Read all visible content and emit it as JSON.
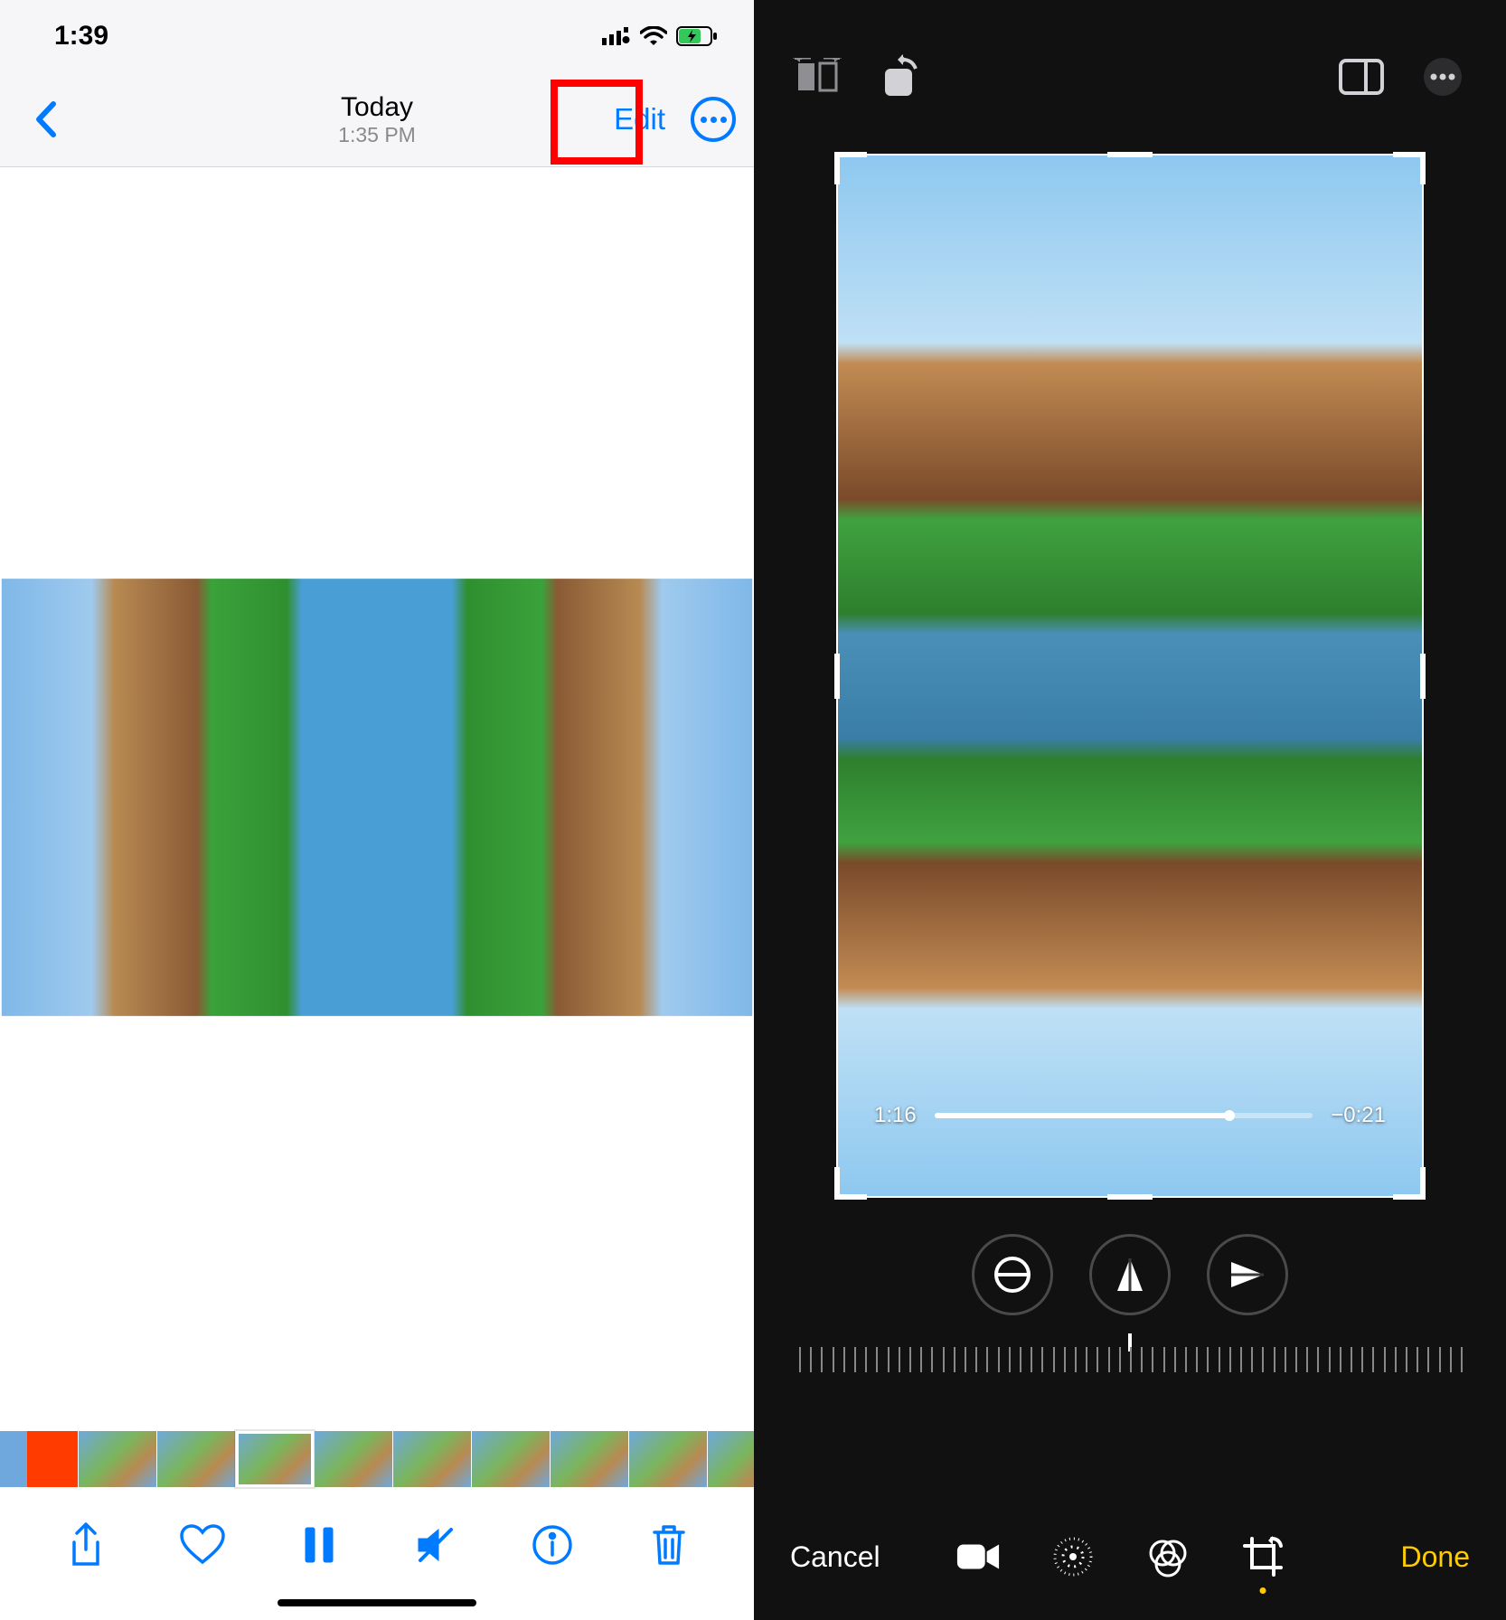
{
  "left": {
    "status": {
      "time": "1:39"
    },
    "nav": {
      "title": "Today",
      "subtitle": "1:35 PM",
      "edit": "Edit"
    }
  },
  "right": {
    "video": {
      "elapsed": "1:16",
      "remaining": "−0:21"
    },
    "bottom": {
      "cancel": "Cancel",
      "done": "Done"
    }
  }
}
